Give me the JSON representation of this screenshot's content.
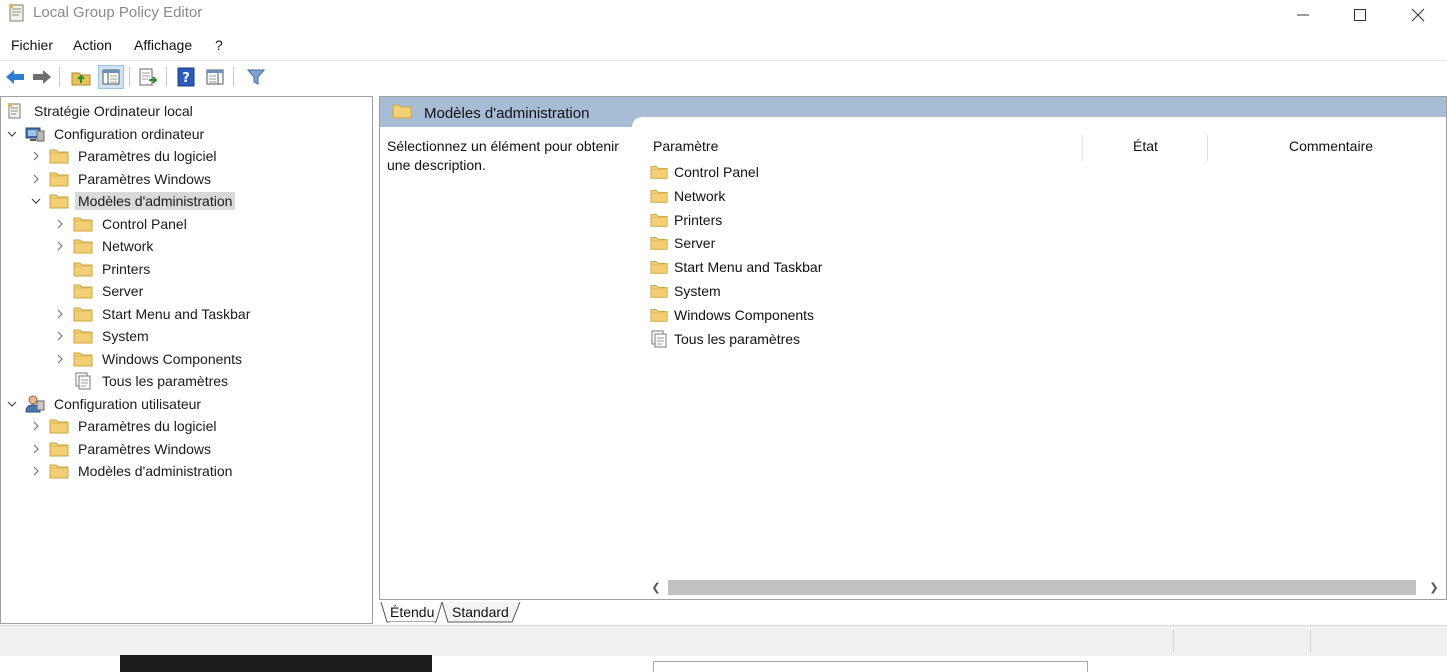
{
  "window": {
    "title": "Local Group Policy Editor",
    "icon": "policy-document-icon",
    "controls": [
      "minimize-icon",
      "maximize-icon",
      "close-icon"
    ]
  },
  "menu": [
    "Fichier",
    "Action",
    "Affichage",
    "?"
  ],
  "toolbar": {
    "buttons": [
      "back-arrow-icon",
      "forward-arrow-icon",
      "up-folder-icon",
      "show-hide-tree-icon",
      "export-list-icon",
      "help-icon",
      "show-hide-action-pane-icon",
      "filter-icon"
    ]
  },
  "tree": {
    "root": "Stratégie Ordinateur local",
    "computer_config": "Configuration ordinateur",
    "computer_children": [
      "Paramètres du logiciel",
      "Paramètres Windows",
      "Modèles d'administration"
    ],
    "admin_children": [
      "Control Panel",
      "Network",
      "Printers",
      "Server",
      "Start Menu and Taskbar",
      "System",
      "Windows Components",
      "Tous les paramètres"
    ],
    "user_config": "Configuration utilisateur",
    "user_children": [
      "Paramètres du logiciel",
      "Paramètres Windows",
      "Modèles d'administration"
    ]
  },
  "details": {
    "header": "Modèles d'administration",
    "description": "Sélectionnez un élément pour obtenir une description.",
    "columns": [
      "Paramètre",
      "État",
      "Commentaire"
    ],
    "items": [
      "Control Panel",
      "Network",
      "Printers",
      "Server",
      "Start Menu and Taskbar",
      "System",
      "Windows Components",
      "Tous les paramètres"
    ]
  },
  "tabs": [
    "Étendu",
    "Standard"
  ],
  "colors": {
    "header_band": "#a7bcd5",
    "selection": "#d9d9d9",
    "folder": "#f2cf74"
  }
}
